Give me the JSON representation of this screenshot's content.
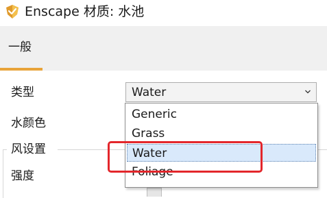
{
  "window": {
    "title": "Enscape 材质: 水池",
    "logo_icon": "enscape-logo-icon"
  },
  "tabs": [
    {
      "label": "一般",
      "active": true
    }
  ],
  "accent_color": "#e8a33a",
  "form": {
    "type_label": "类型",
    "water_color_label": "水颜色",
    "wind_settings_label": "风设置",
    "intensity_label": "强度"
  },
  "type_select": {
    "value": "Water",
    "arrow_icon": "chevron-down-icon",
    "options": [
      "Generic",
      "Grass",
      "Water",
      "Foliage"
    ],
    "highlighted_option": "Water",
    "highlight_color": "#d9e9fb"
  },
  "annotation": {
    "highlight_color": "#e3262b"
  }
}
